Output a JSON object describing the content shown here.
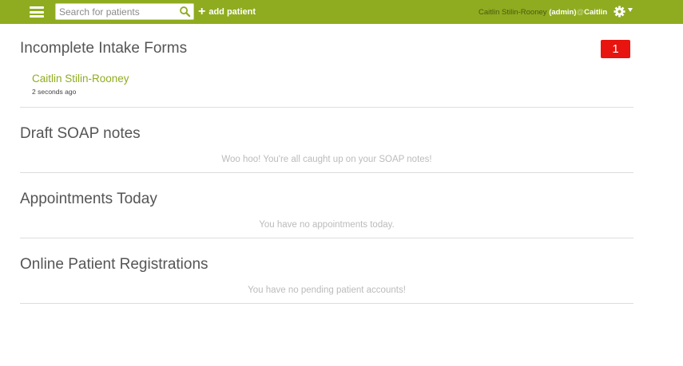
{
  "header": {
    "search_placeholder": "Search for patients",
    "add_patient_label": "add patient",
    "user_name": "Caitlin Stilin-Rooney",
    "user_role": "(admin)",
    "at_symbol": "@",
    "practice_name": "Caitlin",
    "brand_color": "#8fac20"
  },
  "incomplete_intake": {
    "title": "Incomplete Intake Forms",
    "count": "1",
    "items": [
      {
        "patient": "Caitlin Stilin-Rooney",
        "time": "2 seconds ago"
      }
    ]
  },
  "draft_soap": {
    "title": "Draft SOAP notes",
    "empty_message": "Woo hoo! You're all caught up on your SOAP notes!"
  },
  "appointments": {
    "title": "Appointments Today",
    "empty_message": "You have no appointments today."
  },
  "registrations": {
    "title": "Online Patient Registrations",
    "empty_message": "You have no pending patient accounts!"
  }
}
